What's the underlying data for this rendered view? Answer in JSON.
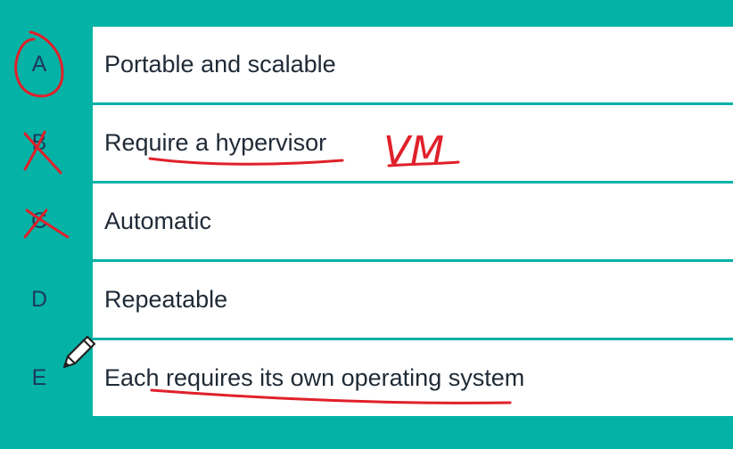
{
  "options": [
    {
      "letter": "A",
      "text": "Portable and scalable",
      "annotation": "circled"
    },
    {
      "letter": "B",
      "text": "Require a hypervisor",
      "annotation": "crossed-out"
    },
    {
      "letter": "C",
      "text": "Automatic",
      "annotation": "crossed-out"
    },
    {
      "letter": "D",
      "text": "Repeatable",
      "annotation": "none"
    },
    {
      "letter": "E",
      "text": "Each requires its own operating system",
      "annotation": "underlined"
    }
  ],
  "handwriting": {
    "note": "VM"
  },
  "colors": {
    "background": "#04b2a6",
    "cell": "#ffffff",
    "ink": "#e0202a",
    "text": "#1f2a36",
    "letter": "#1c3a5a"
  },
  "icons": {
    "cursor": "pencil-icon"
  }
}
